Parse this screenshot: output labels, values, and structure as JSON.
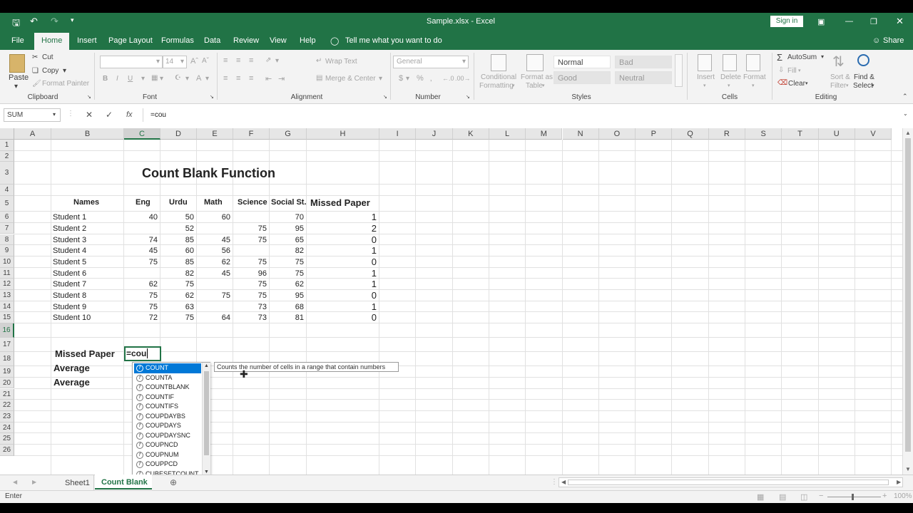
{
  "window": {
    "title": "Sample.xlsx  -  Excel",
    "sign_in": "Sign in"
  },
  "menu": {
    "items": [
      "File",
      "Home",
      "Insert",
      "Page Layout",
      "Formulas",
      "Data",
      "Review",
      "View",
      "Help"
    ],
    "tell_me": "Tell me what you want to do",
    "share": "Share"
  },
  "ribbon": {
    "clipboard": {
      "paste": "Paste",
      "cut": "Cut",
      "copy": "Copy",
      "format_painter": "Format Painter",
      "label": "Clipboard"
    },
    "font": {
      "size": "14",
      "label": "Font",
      "bold": "B",
      "italic": "I",
      "underline": "U"
    },
    "alignment": {
      "wrap_text": "Wrap Text",
      "merge_center": "Merge & Center",
      "label": "Alignment"
    },
    "number": {
      "format": "General",
      "label": "Number"
    },
    "styles": {
      "conditional": "Conditional",
      "formatting": "Formatting",
      "format_as": "Format as",
      "table": "Table",
      "normal": "Normal",
      "bad": "Bad",
      "good": "Good",
      "neutral": "Neutral",
      "label": "Styles"
    },
    "cells": {
      "insert": "Insert",
      "delete": "Delete",
      "format": "Format",
      "label": "Cells"
    },
    "editing": {
      "autosum": "AutoSum",
      "fill": "Fill",
      "clear": "Clear",
      "sort": "Sort &",
      "filter": "Filter",
      "find": "Find &",
      "select": "Select",
      "label": "Editing"
    }
  },
  "formula_bar": {
    "name_box": "SUM",
    "formula": "=cou",
    "fx": "fx"
  },
  "columns": [
    "A",
    "B",
    "C",
    "D",
    "E",
    "F",
    "G",
    "H",
    "I",
    "J",
    "K",
    "L",
    "M",
    "N",
    "O",
    "P",
    "Q",
    "R",
    "S",
    "T",
    "U",
    "V"
  ],
  "rows": [
    "1",
    "2",
    "3",
    "4",
    "5",
    "6",
    "7",
    "8",
    "9",
    "10",
    "11",
    "12",
    "13",
    "14",
    "15",
    "16",
    "17",
    "18",
    "19",
    "20",
    "21",
    "22",
    "23",
    "24",
    "25",
    "26"
  ],
  "sheet": {
    "title": "Count Blank Function",
    "headers": {
      "names": "Names",
      "eng": "Eng",
      "urdu": "Urdu",
      "math": "Math",
      "science": "Science",
      "social": "Social St.",
      "missed": "Missed Paper"
    },
    "students": [
      {
        "name": "Student 1",
        "eng": "40",
        "urdu": "50",
        "math": "60",
        "science": "",
        "social": "70",
        "missed": "1"
      },
      {
        "name": "Student 2",
        "eng": "",
        "urdu": "52",
        "math": "",
        "science": "75",
        "social": "95",
        "missed": "2"
      },
      {
        "name": "Student 3",
        "eng": "74",
        "urdu": "85",
        "math": "45",
        "science": "75",
        "social": "65",
        "missed": "0"
      },
      {
        "name": "Student 4",
        "eng": "45",
        "urdu": "60",
        "math": "56",
        "science": "",
        "social": "82",
        "missed": "1"
      },
      {
        "name": "Student 5",
        "eng": "75",
        "urdu": "85",
        "math": "62",
        "science": "75",
        "social": "75",
        "missed": "0"
      },
      {
        "name": "Student 6",
        "eng": "",
        "urdu": "82",
        "math": "45",
        "science": "96",
        "social": "75",
        "missed": "1"
      },
      {
        "name": "Student 7",
        "eng": "62",
        "urdu": "75",
        "math": "",
        "science": "75",
        "social": "62",
        "missed": "1"
      },
      {
        "name": "Student 8",
        "eng": "75",
        "urdu": "62",
        "math": "75",
        "science": "75",
        "social": "95",
        "missed": "0"
      },
      {
        "name": "Student 9",
        "eng": "75",
        "urdu": "63",
        "math": "",
        "science": "73",
        "social": "68",
        "missed": "1"
      },
      {
        "name": "Student 10",
        "eng": "72",
        "urdu": "75",
        "math": "64",
        "science": "73",
        "social": "81",
        "missed": "0"
      }
    ],
    "footer_labels": [
      "Missed Paper",
      "Average",
      "Average"
    ],
    "editing_cell": "=cou"
  },
  "autocomplete": {
    "items": [
      "COUNT",
      "COUNTA",
      "COUNTBLANK",
      "COUNTIF",
      "COUNTIFS",
      "COUPDAYBS",
      "COUPDAYS",
      "COUPDAYSNC",
      "COUPNCD",
      "COUPNUM",
      "COUPPCD",
      "CUBESETCOUNT"
    ],
    "selected": "COUNT",
    "tooltip": "Counts the number of cells in a range that contain numbers"
  },
  "tabs": {
    "items": [
      "Sheet1",
      "Count Blank"
    ],
    "active": "Count Blank"
  },
  "status": {
    "mode": "Enter",
    "zoom": "100%"
  },
  "colors": {
    "brand": "#217346",
    "selection": "#0078d7"
  }
}
